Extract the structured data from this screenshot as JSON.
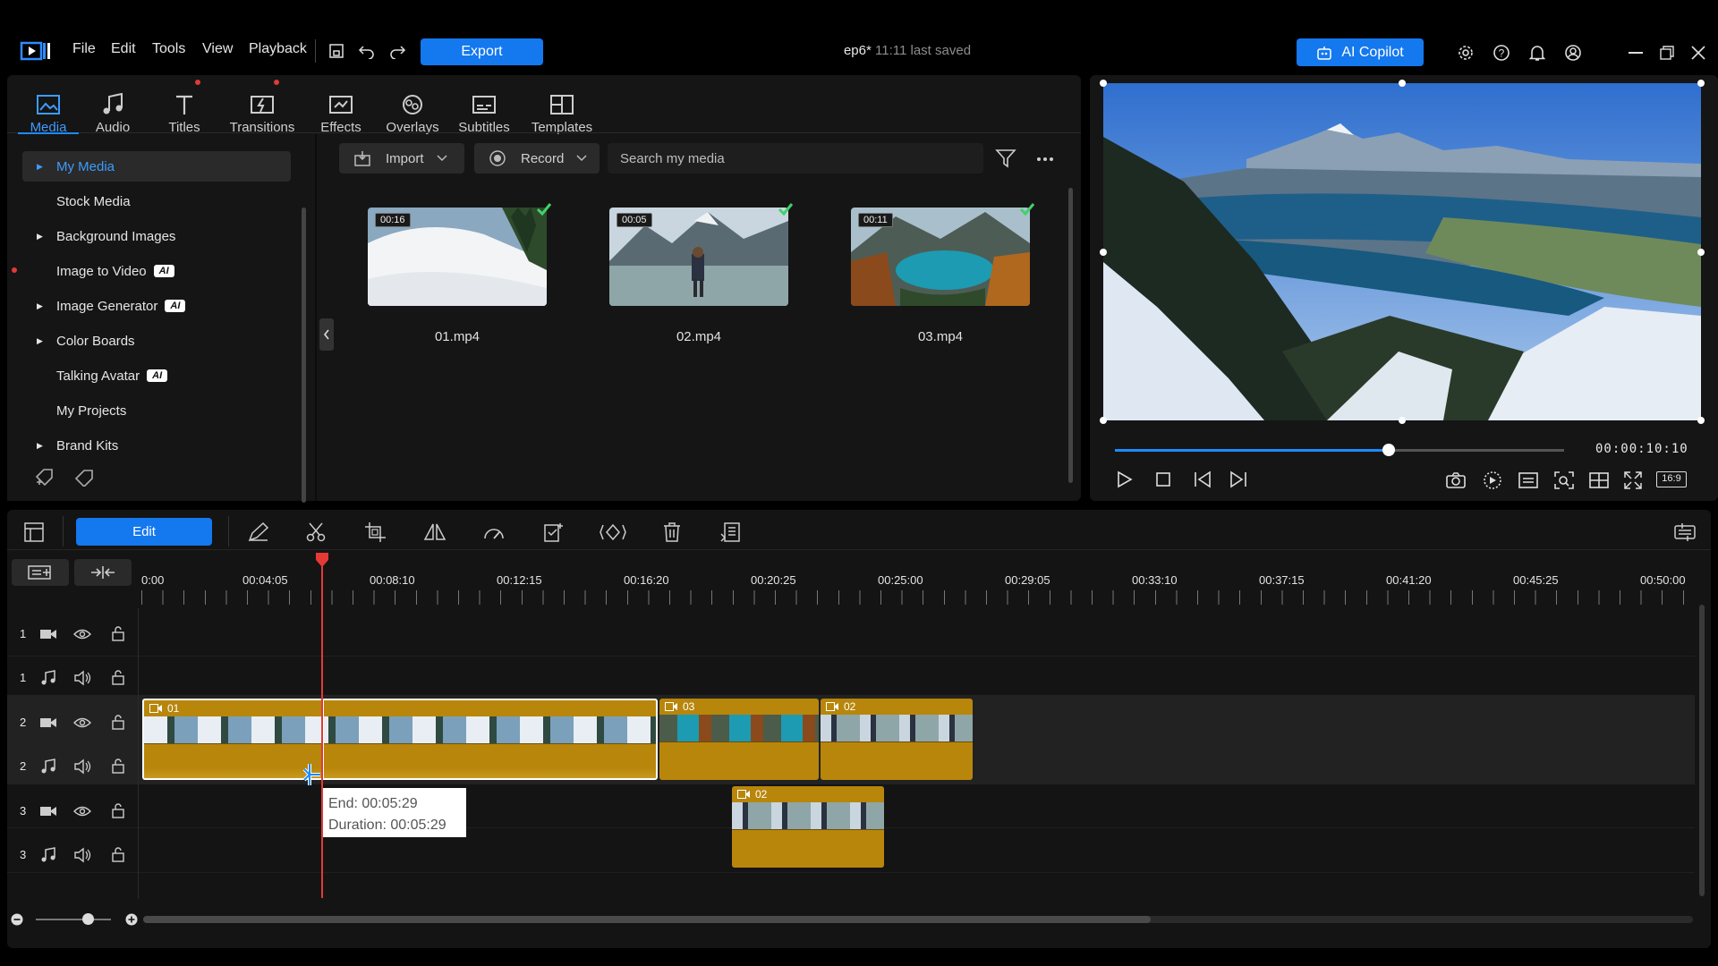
{
  "menu": [
    "File",
    "Edit",
    "Tools",
    "View",
    "Playback"
  ],
  "export_label": "Export",
  "doc": {
    "name": "ep6*",
    "saved": "11:11 last saved"
  },
  "ai_copilot": "AI Copilot",
  "tabs": [
    {
      "label": "Media"
    },
    {
      "label": "Audio"
    },
    {
      "label": "Titles"
    },
    {
      "label": "Transitions"
    },
    {
      "label": "Effects"
    },
    {
      "label": "Overlays"
    },
    {
      "label": "Subtitles"
    },
    {
      "label": "Templates"
    }
  ],
  "sidebar": [
    {
      "label": "My Media"
    },
    {
      "label": "Stock Media"
    },
    {
      "label": "Background Images"
    },
    {
      "label": "Image to Video",
      "ai": "AI"
    },
    {
      "label": "Image Generator",
      "ai": "AI"
    },
    {
      "label": "Color Boards"
    },
    {
      "label": "Talking Avatar",
      "ai": "AI"
    },
    {
      "label": "My Projects"
    },
    {
      "label": "Brand Kits"
    }
  ],
  "media_toolbar": {
    "import": "Import",
    "record": "Record",
    "search_placeholder": "Search my media"
  },
  "media": [
    {
      "name": "01.mp4",
      "duration": "00:16"
    },
    {
      "name": "02.mp4",
      "duration": "00:05"
    },
    {
      "name": "03.mp4",
      "duration": "00:11"
    }
  ],
  "preview": {
    "timecode": "00:00:10:10",
    "progress": 0.61,
    "aspect": "16:9"
  },
  "edit_label": "Edit",
  "ruler": [
    "0:00",
    "00:04:05",
    "00:08:10",
    "00:12:15",
    "00:16:20",
    "00:20:25",
    "00:25:00",
    "00:29:05",
    "00:33:10",
    "00:37:15",
    "00:41:20",
    "00:45:25",
    "00:50:00"
  ],
  "tracks": [
    {
      "num": "1",
      "kind": "video"
    },
    {
      "num": "1",
      "kind": "audio"
    },
    {
      "num": "2",
      "kind": "video"
    },
    {
      "num": "2",
      "kind": "audio"
    },
    {
      "num": "3",
      "kind": "video"
    },
    {
      "num": "3",
      "kind": "audio"
    }
  ],
  "clips": {
    "c1": "01",
    "c2": "03",
    "c3": "02",
    "c4": "02"
  },
  "tooltip": {
    "end": "End: 00:05:29",
    "duration": "Duration: 00:05:29"
  }
}
